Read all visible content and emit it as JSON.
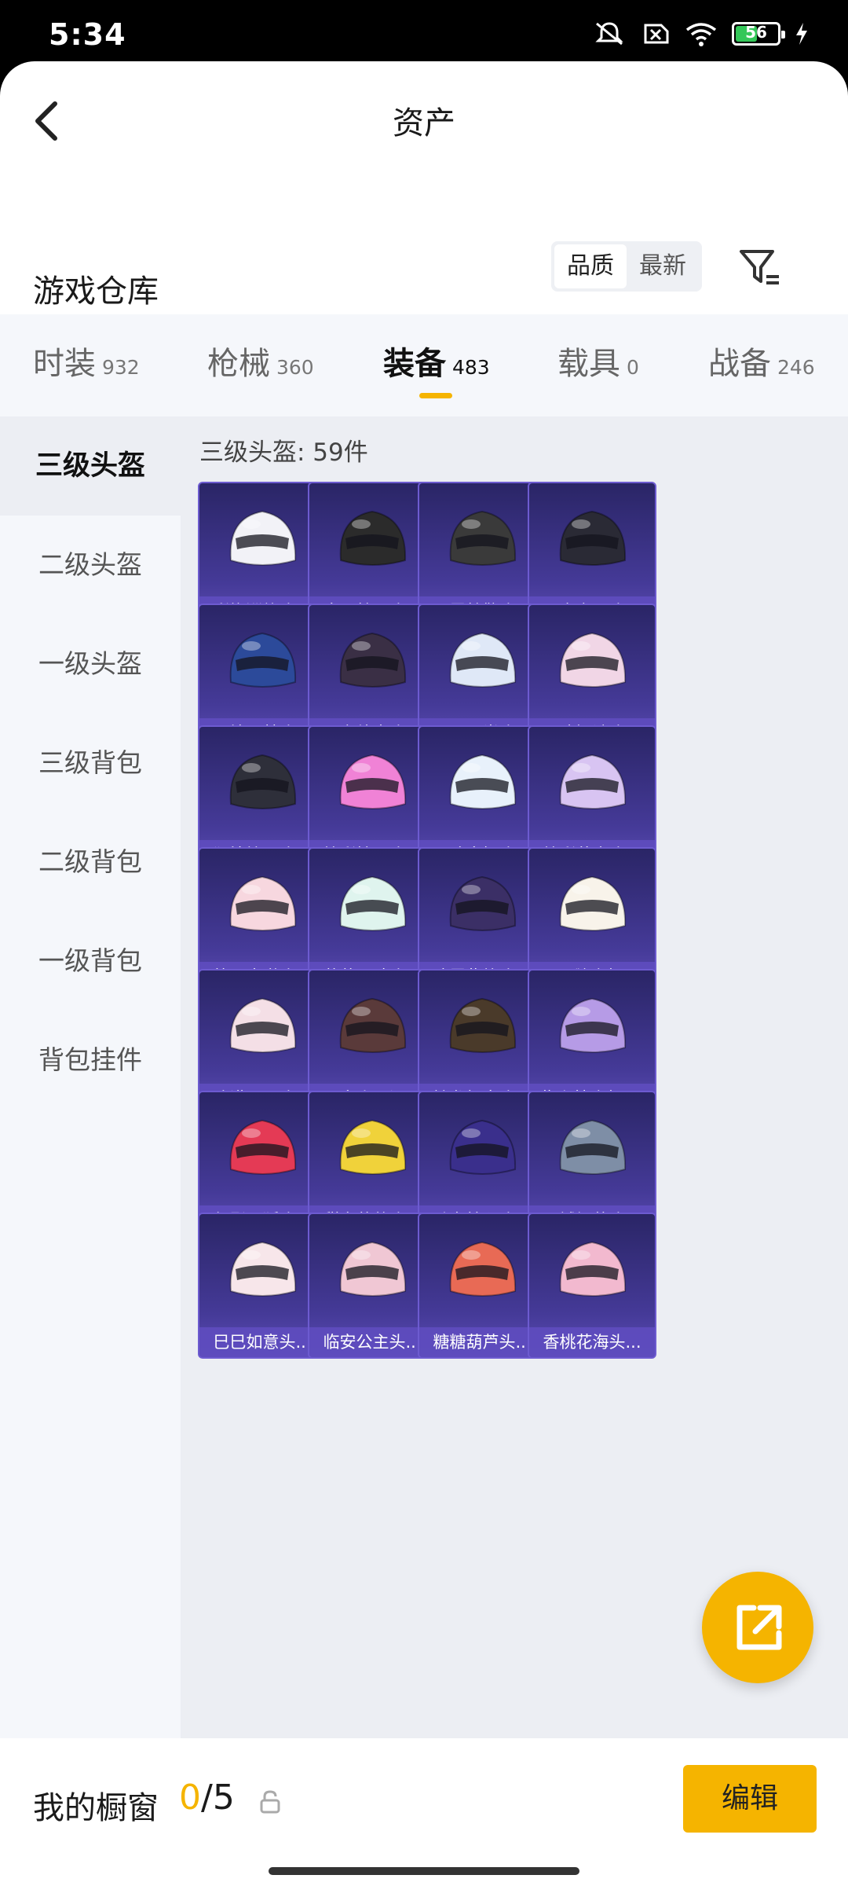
{
  "status": {
    "time": "5:34",
    "battery": "56",
    "battery_level": 0.56,
    "icons": [
      "mute-icon",
      "no-sim-icon",
      "wifi-icon",
      "battery-icon",
      "charging-icon"
    ]
  },
  "header": {
    "title": "资产",
    "back_icon": "chevron-left-icon"
  },
  "warehouse": {
    "title": "游戏仓库",
    "sort": [
      "品质",
      "最新"
    ],
    "filter_icon": "filter-icon"
  },
  "tabs": [
    {
      "label": "时装",
      "count": "932"
    },
    {
      "label": "枪械",
      "count": "360"
    },
    {
      "label": "装备",
      "count": "483"
    },
    {
      "label": "载具",
      "count": "0"
    },
    {
      "label": "战备",
      "count": "246"
    }
  ],
  "active_tab": 2,
  "subcategories": [
    "三级头盔",
    "二级头盔",
    "一级头盔",
    "三级背包",
    "二级背包",
    "一级背包",
    "背包挂件"
  ],
  "section_title": "三级头盔: 59件",
  "items": [
    {
      "name": "彩旗巡礼头...",
      "color": "#f2f2f7"
    },
    {
      "name": "金羽特工头...",
      "color": "#2b2b2b"
    },
    {
      "name": "雷霆特警头...",
      "color": "#3a3a3a"
    },
    {
      "name": "罪夜之冕头...",
      "color": "#2a2a35"
    },
    {
      "name": "画境星梦头...",
      "color": "#2c4a9a"
    },
    {
      "name": "星之彼岸头...",
      "color": "#3a2f45"
    },
    {
      "name": "雪国风尚头...",
      "color": "#dfe8f7"
    },
    {
      "name": "风迹短诗头...",
      "color": "#f1d6e6"
    },
    {
      "name": "狂鲨锋刃头...",
      "color": "#2e2f3a"
    },
    {
      "name": "炫彩糖果头...",
      "color": "#f082d6"
    },
    {
      "name": "异瞳寒姬头...",
      "color": "#e8f1fb"
    },
    {
      "name": "炫彩节奏头...",
      "color": "#d8c4f2"
    },
    {
      "name": "第五大道头...",
      "color": "#f7d7df"
    },
    {
      "name": "薄荷星砂头...",
      "color": "#dff4ee"
    },
    {
      "name": "凌霄紫焰头...",
      "color": "#3b2f66"
    },
    {
      "name": "云朵鹅头盔(...",
      "color": "#f8f3ea"
    },
    {
      "name": "冷漠罗丽头...",
      "color": "#f4dfe6"
    },
    {
      "name": "星穹咏叹调...",
      "color": "#5a3a3a"
    },
    {
      "name": "繁龙极客头...",
      "color": "#4a3a2a"
    },
    {
      "name": "紫幽梦头盔(...",
      "color": "#b69be6"
    },
    {
      "name": "幻影飞狐头...",
      "color": "#e43a55"
    },
    {
      "name": "甜蜜菠萝头...",
      "color": "#f0d23a"
    },
    {
      "name": "动力核心头...",
      "color": "#3a2f8c"
    },
    {
      "name": "异域银装头...",
      "color": "#7e8ea6"
    },
    {
      "name": "巳巳如意头...",
      "color": "#f7e6ea"
    },
    {
      "name": "临安公主头...",
      "color": "#f0c7d4"
    },
    {
      "name": "糖糖葫芦头...",
      "color": "#e86a55"
    },
    {
      "name": "香桃花海头...",
      "color": "#f2b9cf"
    }
  ],
  "fab_icon": "external-link-icon",
  "showcase": {
    "title": "我的橱窗",
    "current": "0",
    "sep_total": "/5",
    "lock_icon": "lock-icon",
    "edit_label": "编辑"
  },
  "colors": {
    "accent": "#f5b400",
    "card_bg": "#453a98",
    "card_label_bg": "#5e4cbe"
  }
}
